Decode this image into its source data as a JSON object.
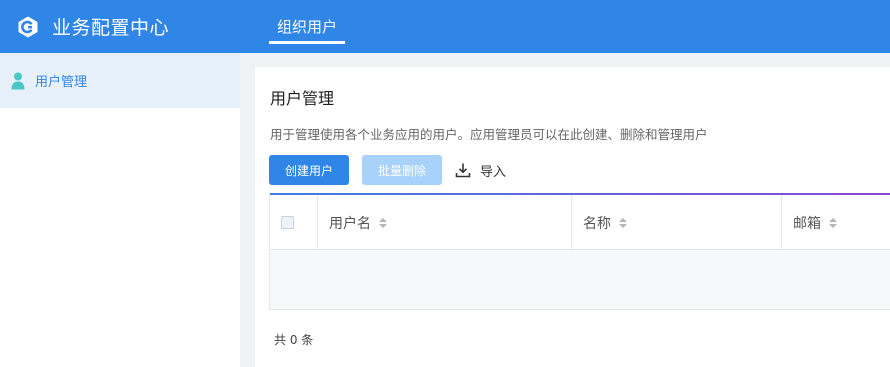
{
  "header": {
    "app_title": "业务配置中心",
    "logo_icon": "brand-c-logo-icon",
    "nav_tab": "组织用户",
    "bg_color": "#2f86e6"
  },
  "sidebar": {
    "items": [
      {
        "label": "用户管理",
        "icon": "user-icon",
        "active": true
      }
    ]
  },
  "main": {
    "title": "用户管理",
    "description": "用于管理使用各个业务应用的用户。应用管理员可以在此创建、删除和管理用户",
    "toolbar": {
      "create_label": "创建用户",
      "batch_delete_label": "批量删除",
      "import_label": "导入"
    },
    "table": {
      "columns": [
        "用户名",
        "名称",
        "邮箱"
      ],
      "rows": []
    },
    "total_text": "共 0 条"
  }
}
